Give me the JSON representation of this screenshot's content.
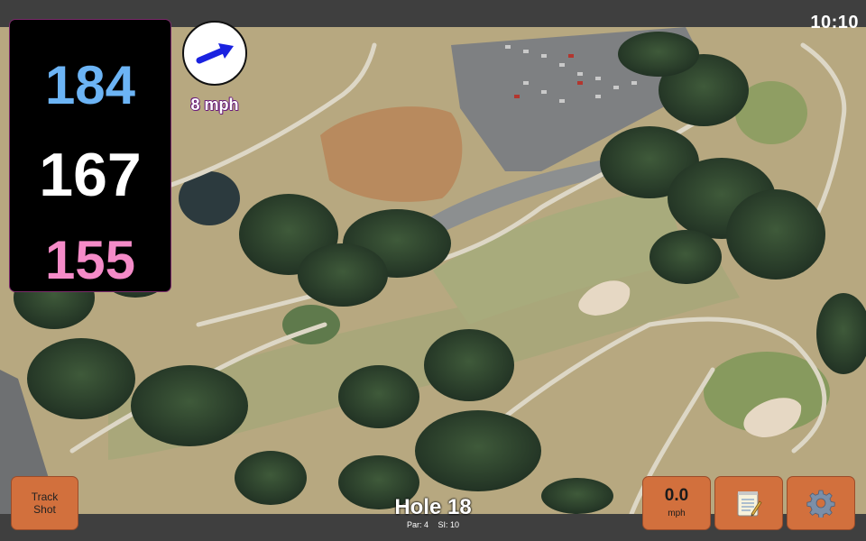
{
  "status": {
    "time": "10:10"
  },
  "distances": {
    "back": "184",
    "middle": "167",
    "front": "155",
    "colors": {
      "back": "#6cb4f5",
      "middle": "#ffffff",
      "front": "#f58bc8"
    }
  },
  "wind": {
    "speed_label": "8 mph",
    "icon": "wind-direction-arrow-icon",
    "arrow_color": "#1a22e0"
  },
  "buttons": {
    "track_shot": {
      "line1": "Track",
      "line2": "Shot"
    },
    "speed": {
      "value": "0.0",
      "unit": "mph"
    },
    "notes": {
      "icon": "notepad-icon"
    },
    "settings": {
      "icon": "gear-icon"
    }
  },
  "hole": {
    "title": "Hole 18",
    "par": "Par: 4",
    "si": "SI: 10"
  },
  "map": {
    "type": "aerial satellite golf course view"
  }
}
